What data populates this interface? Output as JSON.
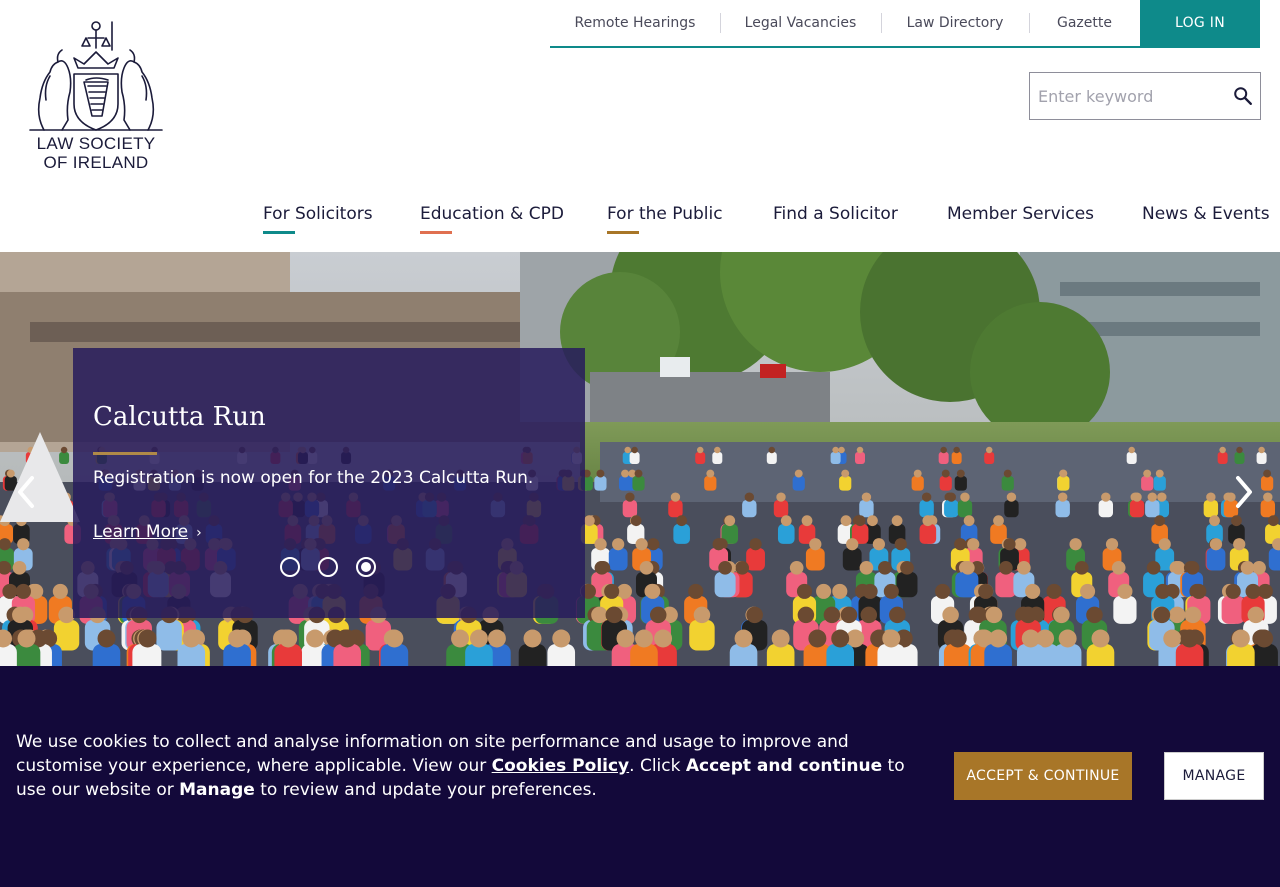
{
  "utility_nav": {
    "links": [
      "Remote Hearings",
      "Legal Vacancies",
      "Law Directory",
      "Gazette"
    ],
    "login_label": "LOG IN"
  },
  "logo": {
    "line1": "LAW SOCIETY",
    "line2": "OF IRELAND",
    "icon": "crest-icon"
  },
  "search": {
    "placeholder": "Enter keyword",
    "icon": "search-icon"
  },
  "main_nav": {
    "items": [
      "For Solicitors",
      "Education & CPD",
      "For the Public",
      "Find a Solicitor",
      "Member Services",
      "News & Events"
    ],
    "accent_colors": [
      "#0e8a8a",
      "#e07050",
      "#a87628"
    ]
  },
  "hero": {
    "title": "Calcutta Run",
    "description": "Registration is now open for the 2023 Calcutta Run.",
    "link_label": "Learn More",
    "slide_count": 3,
    "active_slide": 3,
    "prev_icon": "chevron-left-icon",
    "next_icon": "chevron-right-icon"
  },
  "cookie": {
    "text_1": "We use cookies to collect and analyse information on site performance and usage to improve and customise your experience, where applicable. View our ",
    "policy_link": "Cookies Policy",
    "text_2": ". Click ",
    "accept_phrase": "Accept and continue",
    "text_3": " to use our website or ",
    "manage_phrase": "Manage",
    "text_4": " to review and update your preferences.",
    "accept_label": "ACCEPT & CONTINUE",
    "manage_label": "MANAGE"
  },
  "colors": {
    "teal": "#0e8a8a",
    "gold": "#a87628",
    "navy": "#13093a",
    "card": "#281c5c"
  }
}
